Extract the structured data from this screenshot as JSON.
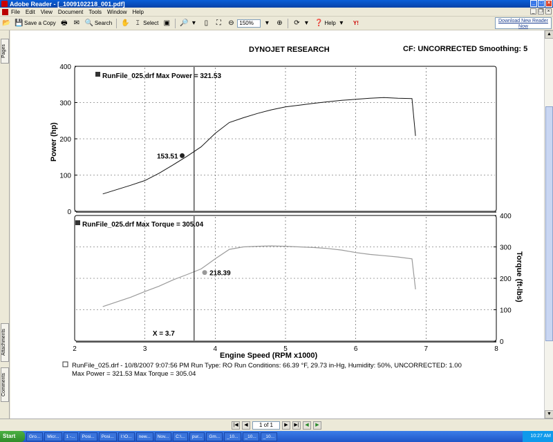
{
  "window": {
    "title": "Adobe Reader - [_1009102218_001.pdf]"
  },
  "menu": [
    "File",
    "Edit",
    "View",
    "Document",
    "Tools",
    "Window",
    "Help"
  ],
  "toolbar": {
    "save_copy": "Save a Copy",
    "search": "Search",
    "select": "Select",
    "zoom": "150%",
    "help": "Help",
    "download": "Download New Reader Now"
  },
  "side_tabs": {
    "pages": "Pages",
    "attachments": "Attachments",
    "comments": "Comments"
  },
  "nav": {
    "page_indicator": "1 of 1"
  },
  "taskbar": {
    "start": "Start",
    "tasks": [
      "Gro...",
      "Micr...",
      "1 -...",
      "Posi...",
      "Posi...",
      "I:\\O...",
      "new...",
      "Nov...",
      "C:\\...",
      "pur...",
      "Gm...",
      "_10...",
      "_10...",
      "_10..."
    ],
    "clock": "10:27 AM"
  },
  "document": {
    "company": "DYNOJET RESEARCH",
    "cf_label": "CF: UNCORRECTED  Smoothing: 5",
    "footer_line1": "RunFile_025.drf - 10/8/2007 9:07:56 PM  Run Type: RO  Run Conditions: 66.39 °F, 29.73 in-Hg,  Humidity:  50%, UNCORRECTED: 1.00",
    "footer_line2": "Max Power = 321.53  Max Torque = 305.04"
  },
  "chart_data": [
    {
      "type": "line",
      "title": "RunFile_025.drf Max Power = 321.53",
      "ylabel": "Power (hp)",
      "xlabel": "",
      "xlim": [
        2,
        8
      ],
      "ylim": [
        0,
        400
      ],
      "y_ticks": [
        "0",
        "100",
        "200",
        "300",
        "400"
      ],
      "grid": true,
      "cursor_x": 3.7,
      "cursor_label": "153.51",
      "cursor_point": [
        3.53,
        153.51
      ],
      "series": [
        {
          "color": "#111111",
          "x": [
            2.4,
            2.8,
            3.0,
            3.2,
            3.4,
            3.6,
            3.8,
            4.0,
            4.2,
            4.4,
            4.6,
            4.8,
            5.0,
            5.2,
            5.4,
            5.6,
            5.8,
            6.0,
            6.2,
            6.4,
            6.6,
            6.8,
            6.85
          ],
          "y": [
            48,
            72,
            85,
            105,
            128,
            152,
            178,
            215,
            245,
            258,
            270,
            280,
            288,
            293,
            298,
            302,
            306,
            309,
            312,
            314,
            312,
            311,
            208
          ]
        }
      ]
    },
    {
      "type": "line",
      "title": "RunFile_025.drf Max Torque = 305.04",
      "ylabel": "Torque (ft-lbs)",
      "xlabel": "Engine Speed (RPM x1000)",
      "xlim": [
        2,
        8
      ],
      "ylim": [
        0,
        400
      ],
      "x_ticks": [
        "2",
        "3",
        "4",
        "5",
        "6",
        "7",
        "8"
      ],
      "y_ticks": [
        "0",
        "100",
        "200",
        "300",
        "400"
      ],
      "grid": true,
      "cursor_x": 3.7,
      "cursor_text": "X = 3.7",
      "cursor_label": "218.39",
      "cursor_point": [
        3.85,
        218.39
      ],
      "series": [
        {
          "color": "#9a9a9a",
          "x": [
            2.4,
            2.8,
            3.0,
            3.2,
            3.4,
            3.6,
            3.8,
            4.0,
            4.2,
            4.4,
            4.6,
            4.8,
            5.0,
            5.2,
            5.4,
            5.6,
            5.8,
            6.0,
            6.2,
            6.4,
            6.6,
            6.8,
            6.85
          ],
          "y": [
            110,
            140,
            158,
            175,
            195,
            212,
            230,
            262,
            292,
            300,
            302,
            303,
            302,
            300,
            298,
            295,
            290,
            282,
            276,
            272,
            268,
            262,
            165
          ]
        }
      ]
    }
  ]
}
